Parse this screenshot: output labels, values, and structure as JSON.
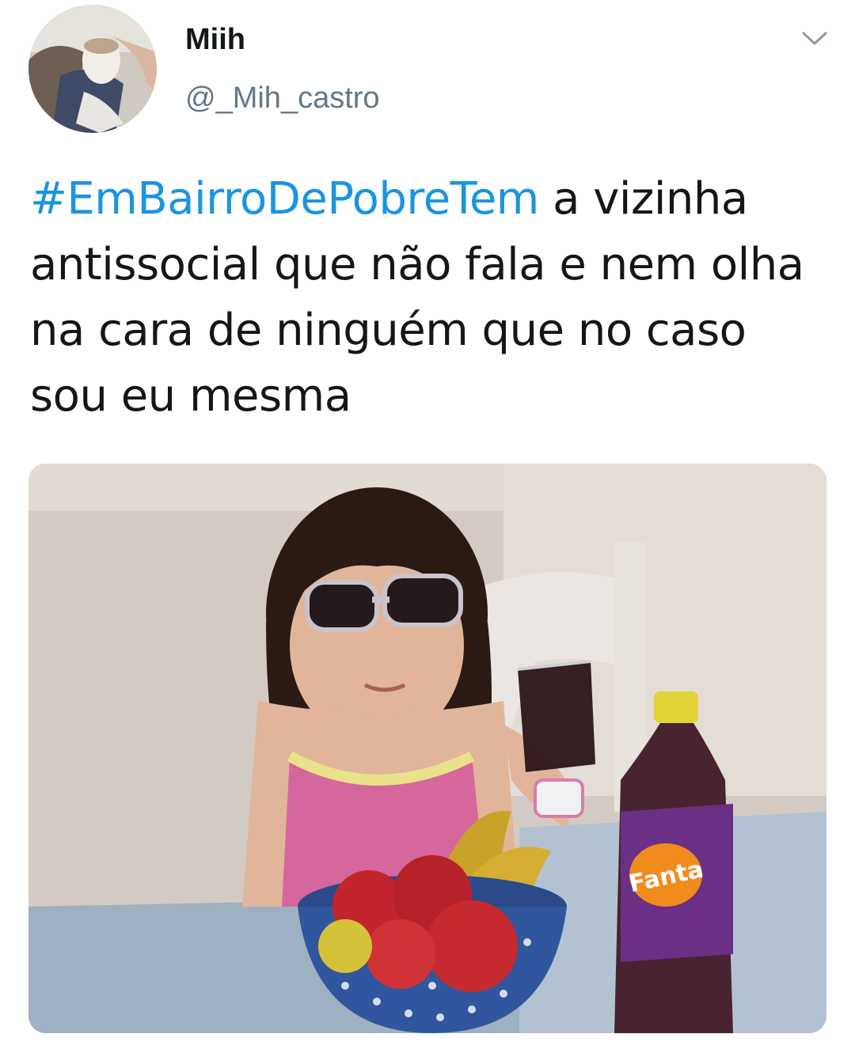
{
  "tweet": {
    "author": {
      "display_name": "Miih",
      "handle": "@_Mih_castro"
    },
    "text": {
      "hashtag": "#EmBairroDePobreTem",
      "body": " a vizinha antissocial que não fala e nem olha na cara de ninguém que no caso sou eu mesma"
    },
    "colors": {
      "hashtag": "#1b95e0",
      "secondary_text": "#657786",
      "primary_text": "#14171a"
    },
    "icons": {
      "menu": "chevron-down-icon"
    },
    "media": {
      "bottle_label": "Fanta"
    }
  }
}
